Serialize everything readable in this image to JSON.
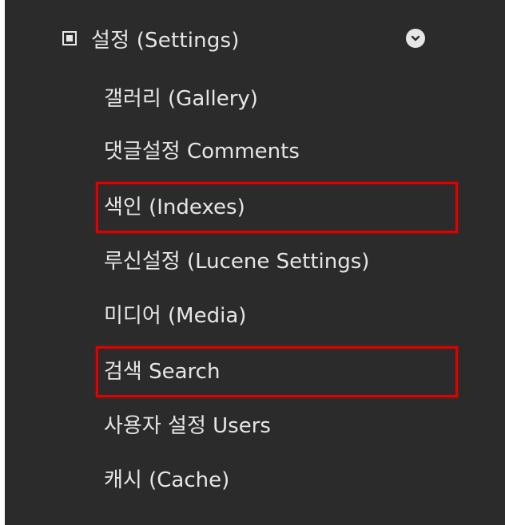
{
  "section": {
    "label": "설정 (Settings)",
    "icon": "square-icon",
    "toggle_icon": "chevron-down-icon"
  },
  "items": [
    {
      "label": "갤러리 (Gallery)"
    },
    {
      "label": "댓글설정 Comments"
    },
    {
      "label": "색인 (Indexes)",
      "highlighted": true
    },
    {
      "label": "루신설정 (Lucene Settings)"
    },
    {
      "label": "미디어 (Media)"
    },
    {
      "label": "검색 Search",
      "highlighted": true
    },
    {
      "label": "사용자 설정 Users"
    },
    {
      "label": "캐시 (Cache)"
    }
  ],
  "colors": {
    "background": "#2b2b2b",
    "text": "#e6e6e6",
    "highlight": "#e00000"
  }
}
